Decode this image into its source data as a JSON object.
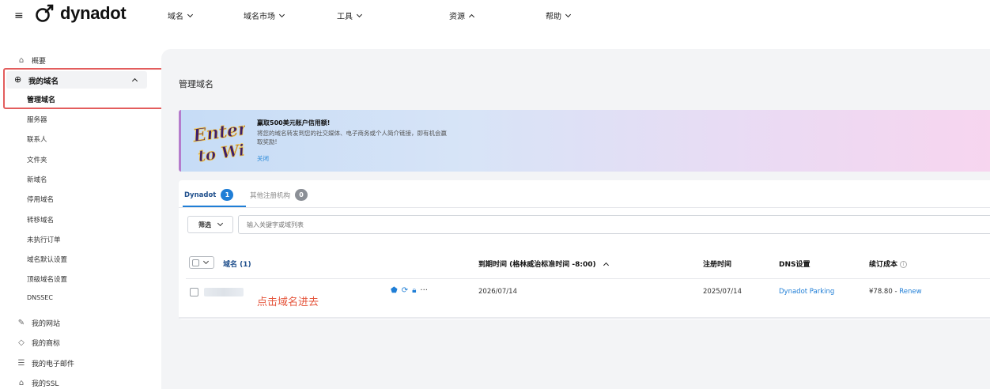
{
  "header": {
    "logo_text": "dynadot",
    "nav": [
      {
        "label": "域名",
        "expanded": false
      },
      {
        "label": "域名市场",
        "expanded": false
      },
      {
        "label": "工具",
        "expanded": false
      },
      {
        "label": "资源",
        "expanded": true
      },
      {
        "label": "帮助",
        "expanded": false
      }
    ]
  },
  "sidebar": {
    "overview": "概要",
    "my_domains": "我的域名",
    "sub_items": [
      "管理域名",
      "服务器",
      "联系人",
      "文件夹",
      "新域名",
      "停用域名",
      "转移域名",
      "未执行订单",
      "域名默认设置",
      "顶级域名设置",
      "DNSSEC"
    ],
    "bottom_items": [
      {
        "label": "我的网站",
        "icon": "pencil-icon"
      },
      {
        "label": "我的商标",
        "icon": "tag-icon"
      },
      {
        "label": "我的电子邮件",
        "icon": "mail-icon"
      },
      {
        "label": "我的SSL",
        "icon": "lock-icon"
      }
    ]
  },
  "main": {
    "page_title": "管理域名",
    "banner": {
      "title": "赢取500美元账户信用额!",
      "description": "将您的域名转发到您的社交媒体、电子商务或个人简介链接，即有机会赢取奖励!",
      "close": "关闭",
      "art_text_1": "Enter",
      "art_text_2": "to Win"
    },
    "tabs": [
      {
        "label": "Dynadot",
        "count": "1",
        "active": true
      },
      {
        "label": "其他注册机构",
        "count": "0",
        "active": false
      }
    ],
    "filter_label": "筛选",
    "search_placeholder": "输入关键字或域列表",
    "table": {
      "headers": {
        "domain": "域名 (1)",
        "expiry": "到期时间 (格林威治标准时间 -8:00)",
        "registered": "注册时间",
        "dns": "DNS设置",
        "renew_cost": "续订成本"
      },
      "rows": [
        {
          "expiry": "2026/07/14",
          "registered": "2025/07/14",
          "dns": "Dynadot Parking",
          "price": "¥78.80",
          "separator": " - ",
          "renew": "Renew"
        }
      ]
    },
    "annotation": "点击域名进去"
  },
  "colors": {
    "accent": "#1f7ed6",
    "highlight": "#e35d5d",
    "annotation": "#e5563d"
  }
}
